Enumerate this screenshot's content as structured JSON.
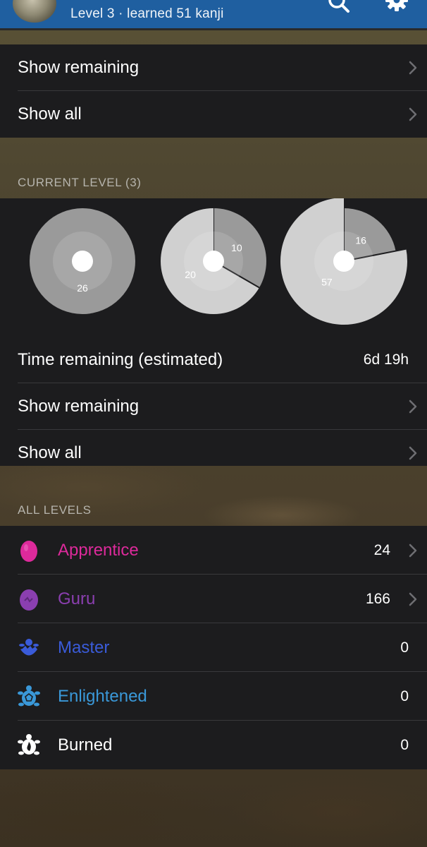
{
  "header": {
    "subtitle": "Level 3 · learned 51 kanji",
    "icons": [
      "avatar",
      "search-icon",
      "gear-icon"
    ]
  },
  "top_group": {
    "rows": [
      {
        "label": "Show remaining"
      },
      {
        "label": "Show all"
      }
    ]
  },
  "current_level": {
    "header": "CURRENT LEVEL (3)",
    "charts": [
      {
        "name": "radicals",
        "segments": [
          {
            "value": 26,
            "color": "#9a9a9a"
          }
        ]
      },
      {
        "name": "kanji",
        "segments": [
          {
            "value": 10,
            "color": "#9a9a9a"
          },
          {
            "value": 20,
            "color": "#d0d0d0"
          }
        ]
      },
      {
        "name": "vocabulary",
        "segments": [
          {
            "value": 16,
            "color": "#9a9a9a"
          },
          {
            "value": 57,
            "color": "#d0d0d0"
          }
        ]
      }
    ],
    "time_label": "Time remaining (estimated)",
    "time_value": "6d 19h",
    "show_remaining": "Show remaining",
    "show_all": "Show all"
  },
  "all_levels": {
    "header": "ALL LEVELS",
    "items": [
      {
        "label": "Apprentice",
        "count": "24",
        "color": "#dd2a9b",
        "icon": "apprentice-egg-icon",
        "chevron": true
      },
      {
        "label": "Guru",
        "count": "166",
        "color": "#8b3fb0",
        "icon": "guru-egg-icon",
        "chevron": true
      },
      {
        "label": "Master",
        "count": "0",
        "color": "#3a5bd9",
        "icon": "master-hatchling-icon",
        "chevron": false
      },
      {
        "label": "Enlightened",
        "count": "0",
        "color": "#3a98d8",
        "icon": "enlightened-turtle-icon",
        "chevron": false
      },
      {
        "label": "Burned",
        "count": "0",
        "color": "#ffffff",
        "icon": "burned-turtle-icon",
        "chevron": false
      }
    ]
  }
}
